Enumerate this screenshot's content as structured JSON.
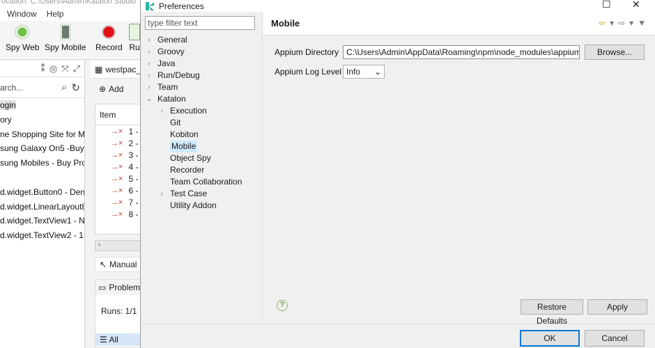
{
  "background_app": {
    "title_fragment": "ocation: C:\\Users\\Admin\\Katalon Studio",
    "menu": [
      "Window",
      "Help"
    ],
    "toolbar": [
      {
        "label": "Spy Web",
        "icon": "spy-web-icon"
      },
      {
        "label": "Spy Mobile",
        "icon": "spy-mobile-icon"
      },
      {
        "label": "Record",
        "icon": "record-icon"
      },
      {
        "label": "Ru",
        "icon": "run-icon"
      }
    ],
    "search_placeholder": "arch...",
    "tree_items": [
      "ogin",
      "ory",
      "ne Shopping Site for Mc",
      "sung Galaxy On5 -Buy S",
      "sung Mobiles - Buy Proc",
      "",
      "d.widget.Button0 - Den",
      "d.widget.LinearLayout8",
      "d.widget.TextView1 - NI",
      "d.widget.TextView2 - 1"
    ],
    "editor_tab": "westpac_l",
    "add_label": "Add",
    "table_header": "Item",
    "table_rows": [
      "1 -",
      "2 -",
      "3 -",
      "4 -",
      "5 -",
      "6 -",
      "7 -",
      "8 -"
    ],
    "manual_tab": "Manual",
    "problems_tab": "Problems",
    "runs": "Runs: 1/1",
    "all_label": "All"
  },
  "dialog": {
    "title": "Preferences",
    "filter_placeholder": "type filter text",
    "tree": [
      {
        "label": "General",
        "expand": "›",
        "level": 1
      },
      {
        "label": "Groovy",
        "expand": "›",
        "level": 1
      },
      {
        "label": "Java",
        "expand": "›",
        "level": 1
      },
      {
        "label": "Run/Debug",
        "expand": "›",
        "level": 1
      },
      {
        "label": "Team",
        "expand": "›",
        "level": 1
      },
      {
        "label": "Katalon",
        "expand": "⌄",
        "level": 1
      },
      {
        "label": "Execution",
        "expand": "›",
        "level": 2
      },
      {
        "label": "Git",
        "expand": "",
        "level": 2
      },
      {
        "label": "Kobiton",
        "expand": "",
        "level": 2
      },
      {
        "label": "Mobile",
        "expand": "",
        "level": 2,
        "selected": true
      },
      {
        "label": "Object Spy",
        "expand": "",
        "level": 2
      },
      {
        "label": "Recorder",
        "expand": "",
        "level": 2
      },
      {
        "label": "Team Collaboration",
        "expand": "",
        "level": 2
      },
      {
        "label": "Test Case",
        "expand": "›",
        "level": 2
      },
      {
        "label": "Utility Addon",
        "expand": "",
        "level": 2
      }
    ],
    "page_title": "Mobile",
    "appium_dir_label": "Appium Directory",
    "appium_dir_value": "C:\\Users\\Admin\\AppData\\Roaming\\npm\\node_modules\\appium",
    "browse_label": "Browse...",
    "log_level_label": "Appium Log Level",
    "log_level_value": "Info",
    "restore_label": "Restore Defaults",
    "apply_label": "Apply",
    "ok_label": "OK",
    "cancel_label": "Cancel",
    "help_symbol": "?"
  }
}
